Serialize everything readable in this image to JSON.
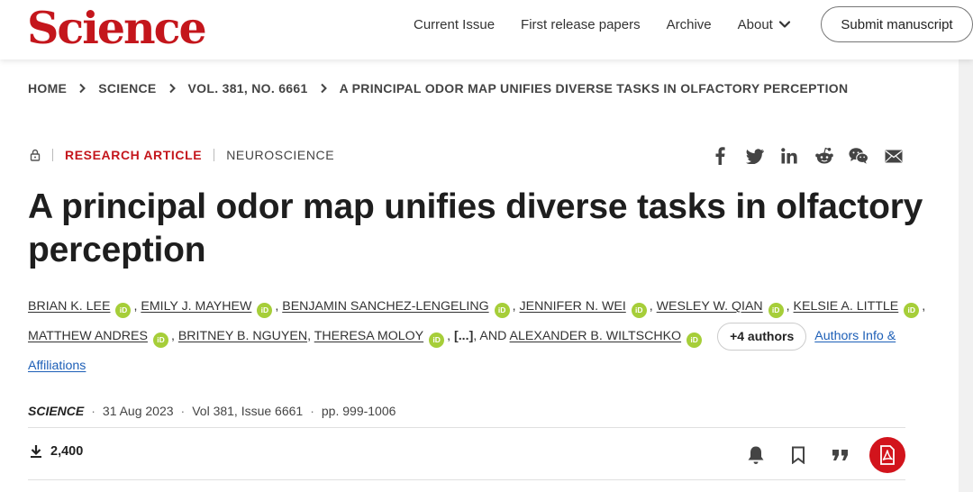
{
  "header": {
    "logo": "Science",
    "nav": [
      {
        "label": "Current Issue"
      },
      {
        "label": "First release papers"
      },
      {
        "label": "Archive"
      },
      {
        "label": "About"
      }
    ],
    "submit_label": "Submit manuscript"
  },
  "breadcrumb": [
    "HOME",
    "SCIENCE",
    "VOL. 381, NO. 6661",
    "A PRINCIPAL ODOR MAP UNIFIES DIVERSE TASKS IN OLFACTORY PERCEPTION"
  ],
  "article": {
    "type": "RESEARCH ARTICLE",
    "subject": "NEUROSCIENCE",
    "title": "A principal odor map unifies diverse tasks in olfactory perception",
    "authors": [
      "BRIAN K. LEE",
      "EMILY J. MAYHEW",
      "BENJAMIN SANCHEZ-LENGELING",
      "JENNIFER N. WEI",
      "WESLEY W. QIAN",
      "KELSIE A. LITTLE",
      "MATTHEW ANDRES",
      "BRITNEY B. NGUYEN",
      "THERESA MOLOY",
      "ALEXANDER B. WILTSCHKO"
    ],
    "orcid_label": "iD",
    "ellipsis": "[...]",
    "and_label": "AND",
    "more_authors_label": "+4 authors",
    "info_link": "Authors Info & Affiliations",
    "journal": "SCIENCE",
    "date": "31 Aug 2023",
    "volume": "Vol 381, Issue 6661",
    "pages": "pp. 999-1006",
    "downloads": "2,400"
  },
  "colors": {
    "brand_red": "#c4161c",
    "orcid_green": "#a6ce39",
    "link_blue": "#1d5fb7"
  },
  "icons": {
    "share": [
      "facebook-icon",
      "twitter-icon",
      "linkedin-icon",
      "reddit-icon",
      "wechat-icon",
      "email-icon"
    ],
    "tools": [
      "bell-icon",
      "bookmark-icon",
      "quote-icon",
      "pdf-icon"
    ]
  }
}
